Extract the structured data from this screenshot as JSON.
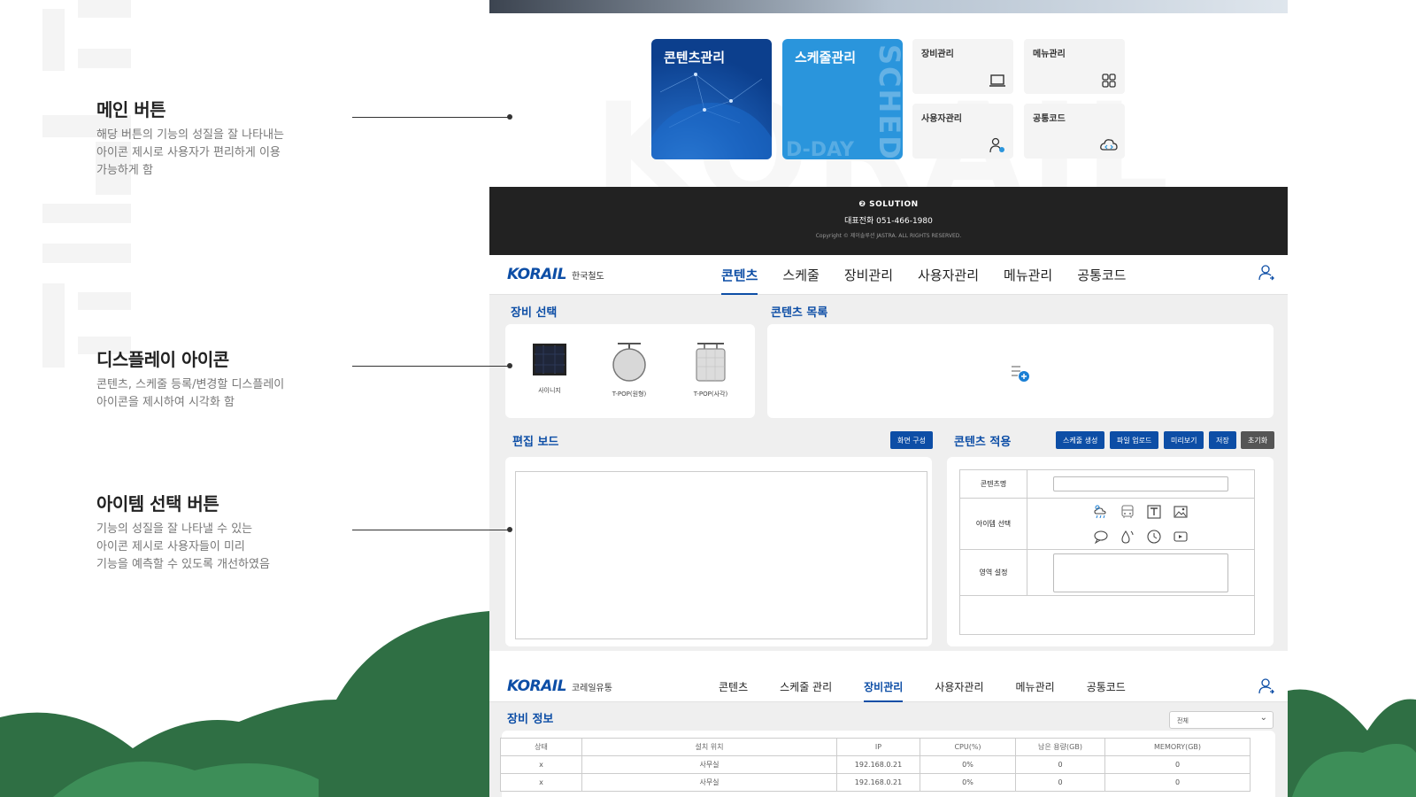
{
  "annotations": [
    {
      "title": "메인 버튼",
      "desc": [
        "해당 버튼의 기능의 성질을 잘 나타내는",
        "아이콘 제시로 사용자가 편리하게 이용",
        "가능하게 함"
      ]
    },
    {
      "title": "디스플레이 아이콘",
      "desc": [
        "콘텐츠, 스케줄 등록/변경할 디스플레이",
        "아이콘을 제시하여 시각화 함"
      ]
    },
    {
      "title": "아이템 선택 버튼",
      "desc": [
        "기능의 성질을 잘 나타낼 수 있는",
        "아이콘 제시로 사용자들이 미리",
        "기능을 예측할 수 있도록 개선하였음"
      ]
    }
  ],
  "tiles": {
    "content": {
      "label": "콘텐츠관리"
    },
    "schedule": {
      "label": "스케줄관리",
      "vertical_text": "SCHED",
      "dday": "D-DAY"
    },
    "device": {
      "label": "장비관리",
      "icon": "monitor-icon"
    },
    "menu": {
      "label": "메뉴관리",
      "icon": "grid-icon"
    },
    "user": {
      "label": "사용자관리",
      "icon": "user-settings-icon"
    },
    "code": {
      "label": "공통코드",
      "icon": "cloud-code-icon"
    }
  },
  "footer": {
    "logo": "❷ SOLUTION",
    "tel": "대표전화 051-466-1980",
    "copyright": "Copyright © 제이솔루션 JASTRA. ALL RIGHTS RESERVED."
  },
  "screen1": {
    "brand": {
      "name": "KORAIL",
      "sub": "한국철도"
    },
    "menu": [
      "콘텐츠",
      "스케줄",
      "장비관리",
      "사용자관리",
      "메뉴관리",
      "공통코드"
    ],
    "active_menu": "콘텐츠",
    "device_select": {
      "title": "장비 선택",
      "devices": [
        {
          "label": "사이니지",
          "icon": "signage-icon"
        },
        {
          "label": "T-POP(원형)",
          "icon": "tpop-round-icon"
        },
        {
          "label": "T-POP(사각)",
          "icon": "tpop-square-icon"
        }
      ]
    },
    "content_list": {
      "title": "콘텐츠 목록",
      "icon": "add-document-icon"
    },
    "edit_board": {
      "title": "편집 보드",
      "button": "화면 구성"
    },
    "content_apply": {
      "title": "콘텐츠 적용",
      "buttons": [
        "스케줄 생성",
        "파일 업로드",
        "미리보기",
        "저장",
        "초기화"
      ],
      "rows": {
        "name": "콘텐츠명",
        "item_select": "아이템 선택",
        "area": "영역 설정"
      },
      "item_icons": [
        "weather-icon",
        "bus-icon",
        "text-icon",
        "image-icon",
        "chat-icon",
        "drop-icon",
        "clock-icon",
        "video-icon"
      ]
    }
  },
  "screen2": {
    "brand": {
      "name": "KORAIL",
      "sub": "코레일유통"
    },
    "menu": [
      "콘텐츠",
      "스케줄 관리",
      "장비관리",
      "사용자관리",
      "메뉴관리",
      "공통코드"
    ],
    "active_menu": "장비관리",
    "section_title": "장비 정보",
    "filter": "전체",
    "table": {
      "headers": [
        "상태",
        "설치 위치",
        "IP",
        "CPU(%)",
        "남은 용량(GB)",
        "MEMORY(GB)"
      ],
      "rows": [
        [
          "x",
          "사무실",
          "192.168.0.21",
          "0%",
          "0",
          "0"
        ],
        [
          "x",
          "사무실",
          "192.168.0.21",
          "0%",
          "0",
          "0"
        ]
      ]
    }
  },
  "colors": {
    "brand_blue": "#0d4ea6",
    "tile_blue": "#2a95dc",
    "hill_green": "#2f7a48",
    "footer_dark": "#222222"
  }
}
